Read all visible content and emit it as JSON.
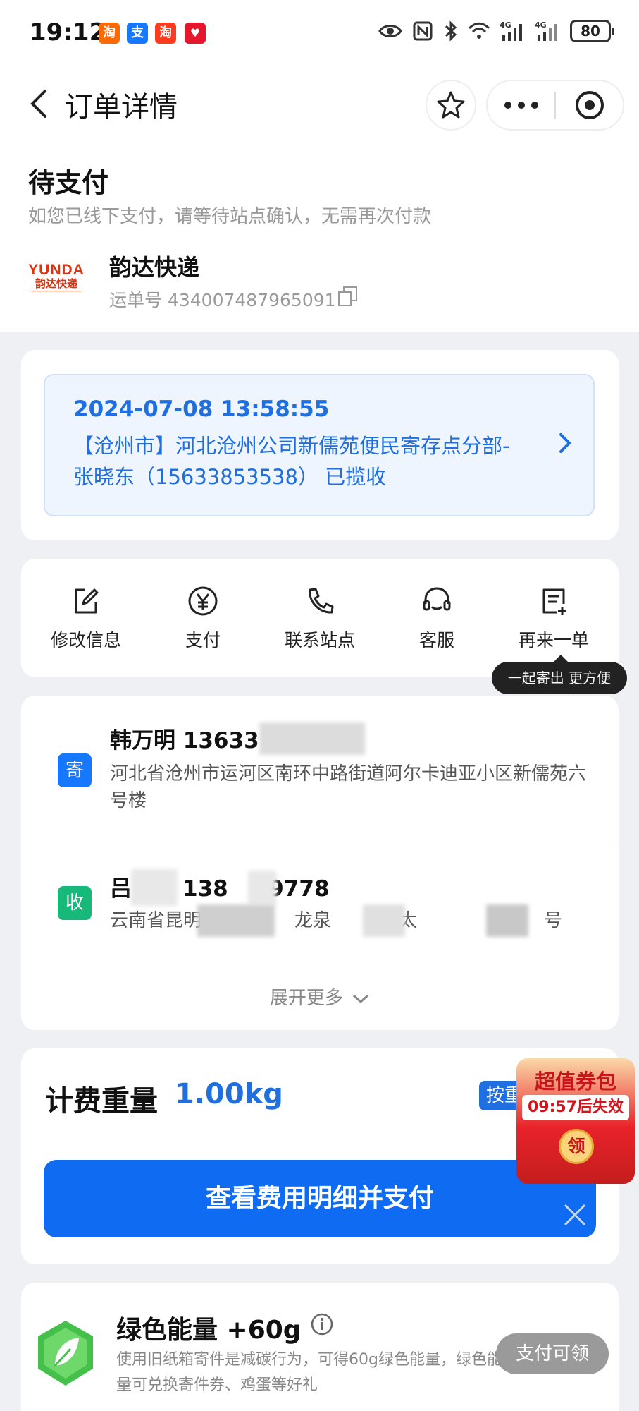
{
  "status_bar": {
    "time": "19:12",
    "apps": [
      {
        "label": "淘",
        "color": "#ff6a00"
      },
      {
        "label": "支",
        "color": "#1677ff"
      },
      {
        "label": "淘",
        "color": "#ff3b1f"
      },
      {
        "label": "♥",
        "color": "#e6162d"
      }
    ],
    "battery": "80"
  },
  "nav": {
    "title": "订单详情"
  },
  "order": {
    "status_title": "待支付",
    "status_subtitle": "如您已线下支付，请等待站点确认，无需再次付款",
    "carrier_logo_en": "YUNDA",
    "carrier_logo_cn": "韵达快递",
    "carrier_name": "韵达快递",
    "waybill_label": "运单号 434007487965091"
  },
  "tracking": {
    "datetime": "2024-07-08 13:58:55",
    "text": "【沧州市】河北沧州公司新儒苑便民寄存点分部-张晓东（15633853538） 已揽收"
  },
  "actions": [
    {
      "label": "修改信息",
      "icon": "edit-icon"
    },
    {
      "label": "支付",
      "icon": "yuan-icon"
    },
    {
      "label": "联系站点",
      "icon": "phone-icon"
    },
    {
      "label": "客服",
      "icon": "headset-icon"
    },
    {
      "label": "再来一单",
      "icon": "reorder-icon"
    }
  ],
  "tooltip": "一起寄出 更方便",
  "sender": {
    "tag": "寄",
    "name": "韩万明 13633",
    "address": "河北省沧州市运河区南环中路街道阿尔卡迪亚小区新儒苑六号楼"
  },
  "receiver": {
    "tag": "收",
    "name_a": "吕",
    "name_b": "138",
    "name_c": "09778",
    "address_a": "云南省昆明市五",
    "address_b": "龙泉",
    "address_c": "金太",
    "address_d": "号"
  },
  "expand_more": "展开更多",
  "fee": {
    "weight_label": "计费重量",
    "weight_value": "1.00kg",
    "tag": "按重",
    "pay_button": "查看费用明细并支付"
  },
  "promo": {
    "title": "超值券包",
    "countdown": "09:57后失效",
    "coin": "领"
  },
  "energy": {
    "title": "绿色能量 +60g",
    "desc": "使用旧纸箱寄件是减碳行为，可得60g绿色能量，绿色能量可兑换寄件券、鸡蛋等好礼",
    "button": "支付可领"
  },
  "colors": {
    "accent": "#1f6fe0",
    "pay_button": "#0f6cf2",
    "sender_tag": "#1677ff",
    "receiver_tag": "#17b97a"
  }
}
